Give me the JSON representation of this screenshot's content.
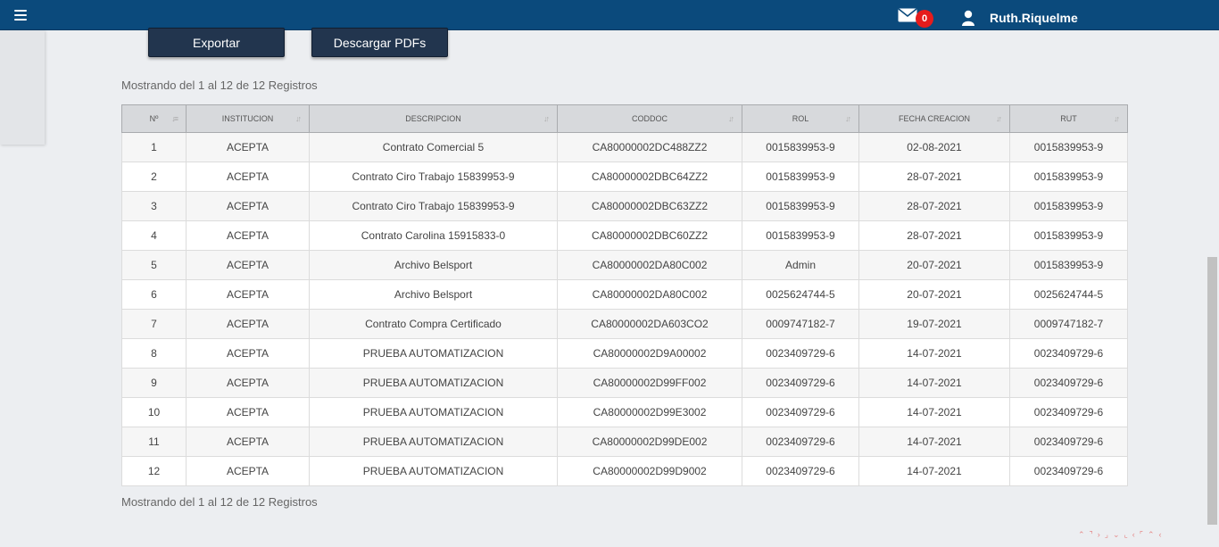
{
  "header": {
    "user_name": "Ruth.Riquelme",
    "mail_count": "0",
    "colors": {
      "bar": "#0b4a7c",
      "badge": "#e61c1c"
    }
  },
  "toolbar": {
    "export_label": "Exportar",
    "pdf_label": "Descargar PDFs"
  },
  "info": {
    "top": "Mostrando del 1 al 12 de 12 Registros",
    "bottom": "Mostrando del 1 al 12 de 12 Registros"
  },
  "table": {
    "columns": [
      "Nº",
      "INSTITUCION",
      "DESCRIPCION",
      "CODDOC",
      "ROL",
      "FECHA CREACION",
      "RUT"
    ],
    "rows": [
      [
        "1",
        "ACEPTA",
        "Contrato Comercial 5",
        "CA80000002DC488ZZ2",
        "0015839953-9",
        "02-08-2021",
        "0015839953-9"
      ],
      [
        "2",
        "ACEPTA",
        "Contrato Ciro Trabajo 15839953-9",
        "CA80000002DBC64ZZ2",
        "0015839953-9",
        "28-07-2021",
        "0015839953-9"
      ],
      [
        "3",
        "ACEPTA",
        "Contrato Ciro Trabajo 15839953-9",
        "CA80000002DBC63ZZ2",
        "0015839953-9",
        "28-07-2021",
        "0015839953-9"
      ],
      [
        "4",
        "ACEPTA",
        "Contrato Carolina 15915833-0",
        "CA80000002DBC60ZZ2",
        "0015839953-9",
        "28-07-2021",
        "0015839953-9"
      ],
      [
        "5",
        "ACEPTA",
        "Archivo Belsport",
        "CA80000002DA80C002",
        "Admin",
        "20-07-2021",
        "0015839953-9"
      ],
      [
        "6",
        "ACEPTA",
        "Archivo Belsport",
        "CA80000002DA80C002",
        "0025624744-5",
        "20-07-2021",
        "0025624744-5"
      ],
      [
        "7",
        "ACEPTA",
        "Contrato Compra Certificado",
        "CA80000002DA603CO2",
        "0009747182-7",
        "19-07-2021",
        "0009747182-7"
      ],
      [
        "8",
        "ACEPTA",
        "PRUEBA AUTOMATIZACION",
        "CA80000002D9A00002",
        "0023409729-6",
        "14-07-2021",
        "0023409729-6"
      ],
      [
        "9",
        "ACEPTA",
        "PRUEBA AUTOMATIZACION",
        "CA80000002D99FF002",
        "0023409729-6",
        "14-07-2021",
        "0023409729-6"
      ],
      [
        "10",
        "ACEPTA",
        "PRUEBA AUTOMATIZACION",
        "CA80000002D99E3002",
        "0023409729-6",
        "14-07-2021",
        "0023409729-6"
      ],
      [
        "11",
        "ACEPTA",
        "PRUEBA AUTOMATIZACION",
        "CA80000002D99DE002",
        "0023409729-6",
        "14-07-2021",
        "0023409729-6"
      ],
      [
        "12",
        "ACEPTA",
        "PRUEBA AUTOMATIZACION",
        "CA80000002D99D9002",
        "0023409729-6",
        "14-07-2021",
        "0023409729-6"
      ]
    ]
  }
}
